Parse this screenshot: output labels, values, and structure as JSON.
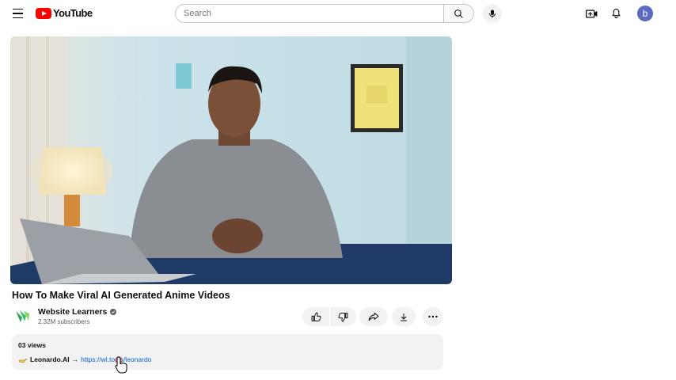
{
  "header": {
    "logo_text": "YouTube",
    "search_placeholder": "Search",
    "avatar_letter": "b"
  },
  "video": {
    "title": "How To Make Viral AI Generated Anime Videos"
  },
  "channel": {
    "name": "Website Learners",
    "subscribers": "2.32M subscribers"
  },
  "description": {
    "views": "03 views",
    "brand": "Leonardo.AI",
    "arrow": "→",
    "link": "https://wl.tools/leonardo"
  },
  "colors": {
    "brand_red": "#ff0000",
    "link_blue": "#065fd4",
    "avatar_bg": "#5c6bc0"
  }
}
